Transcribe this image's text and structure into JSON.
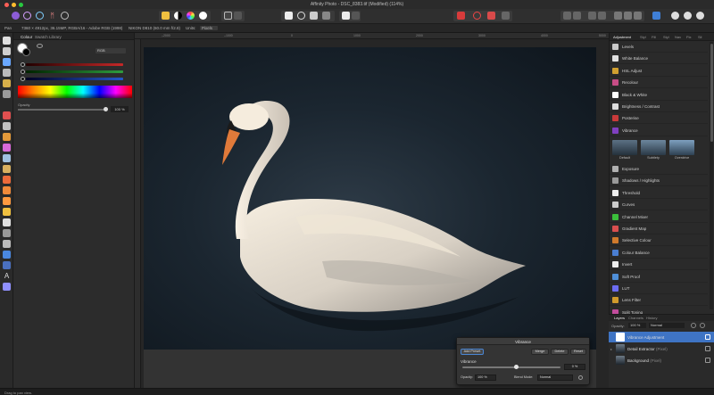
{
  "window": {
    "title": "Affinity Photo - DSC_8383.tif (Modified) (114%)"
  },
  "context_bar": {
    "tool_name": "Pan",
    "doc_info": "7360 × 4912px, 36.15MP, RGBA/16 - Adobe RGB (1998)",
    "camera_info": "NIKON D810 (60.0 mm f/2.8)",
    "units_label": "Units:",
    "units_value": "Pixels"
  },
  "colour_panel": {
    "tabs": [
      "Colour",
      "Swatch",
      "Library"
    ],
    "mode_label": "RGB",
    "rgb_labels": [
      "R",
      "G",
      "B"
    ],
    "opacity_label": "Opacity",
    "opacity_value": "100 %",
    "colors": {
      "red": "#c62828",
      "green": "#2e9d3e",
      "blue": "#2456c9"
    }
  },
  "adjustment_panel": {
    "tabs": [
      "Adjustment",
      "Styl",
      "Fill",
      "Styl",
      "Nav",
      "Ftx",
      "Sil"
    ],
    "items_top": [
      {
        "label": "Levels",
        "swatch": "#c9c9c9"
      },
      {
        "label": "White Balance",
        "swatch": "#e0e0e0"
      },
      {
        "label": "HSL Adjust",
        "swatch": "#d0a030"
      },
      {
        "label": "Recolour",
        "swatch": "#c84d86"
      },
      {
        "label": "Black & White",
        "swatch": "#ffffff"
      },
      {
        "label": "Brightness / Contrast",
        "swatch": "#dddddd"
      },
      {
        "label": "Posterise",
        "swatch": "#c93a3a"
      },
      {
        "label": "Vibrance",
        "swatch": "#8040c0"
      }
    ],
    "presets": [
      "Default",
      "Subtlety",
      "Overdrive"
    ],
    "items_bottom": [
      {
        "label": "Exposure",
        "swatch": "#b0b0b0"
      },
      {
        "label": "Shadows / Highlights",
        "swatch": "#9a9a9a"
      },
      {
        "label": "Threshold",
        "swatch": "#eeeeee"
      },
      {
        "label": "Curves",
        "swatch": "#cccccc"
      },
      {
        "label": "Channel Mixer",
        "swatch": "#3bbf3b"
      },
      {
        "label": "Gradient Map",
        "swatch": "#d94f4f"
      },
      {
        "label": "Selective Colour",
        "swatch": "#d07a2c"
      },
      {
        "label": "Colour Balance",
        "swatch": "#4a7ed1"
      },
      {
        "label": "Invert",
        "swatch": "#eeeeee"
      },
      {
        "label": "Soft Proof",
        "swatch": "#4f8fd8"
      },
      {
        "label": "LUT",
        "swatch": "#6c6cf0"
      },
      {
        "label": "Lens Filter",
        "swatch": "#d09a2c"
      },
      {
        "label": "Split Toning",
        "swatch": "#c24c9c"
      }
    ]
  },
  "layers_panel": {
    "tabs": [
      "Layers",
      "Channels",
      "History"
    ],
    "opacity_label": "Opacity:",
    "opacity_value": "100 %",
    "blend_value": "Normal",
    "layers": [
      {
        "name": "Vibrance Adjustment",
        "selected": true
      },
      {
        "name": "Detail Extractor",
        "suffix": "(Pixel)",
        "selected": false
      },
      {
        "name": "Background",
        "suffix": "(Pixel)",
        "selected": false
      }
    ]
  },
  "vibrance_dialog": {
    "title": "Vibrance",
    "add_preset": "Add Preset",
    "merge": "Merge",
    "delete": "Delete",
    "reset": "Reset",
    "vibrance_label": "Vibrance",
    "vibrance_value": "0 %",
    "vibrance_level": 0.55,
    "opacity_label": "Opacity:",
    "opacity_value": "100 %",
    "blend_mode_label": "Blend Mode:",
    "blend_mode_value": "Normal"
  },
  "status_bar": {
    "hint": "Drag to pan view."
  }
}
